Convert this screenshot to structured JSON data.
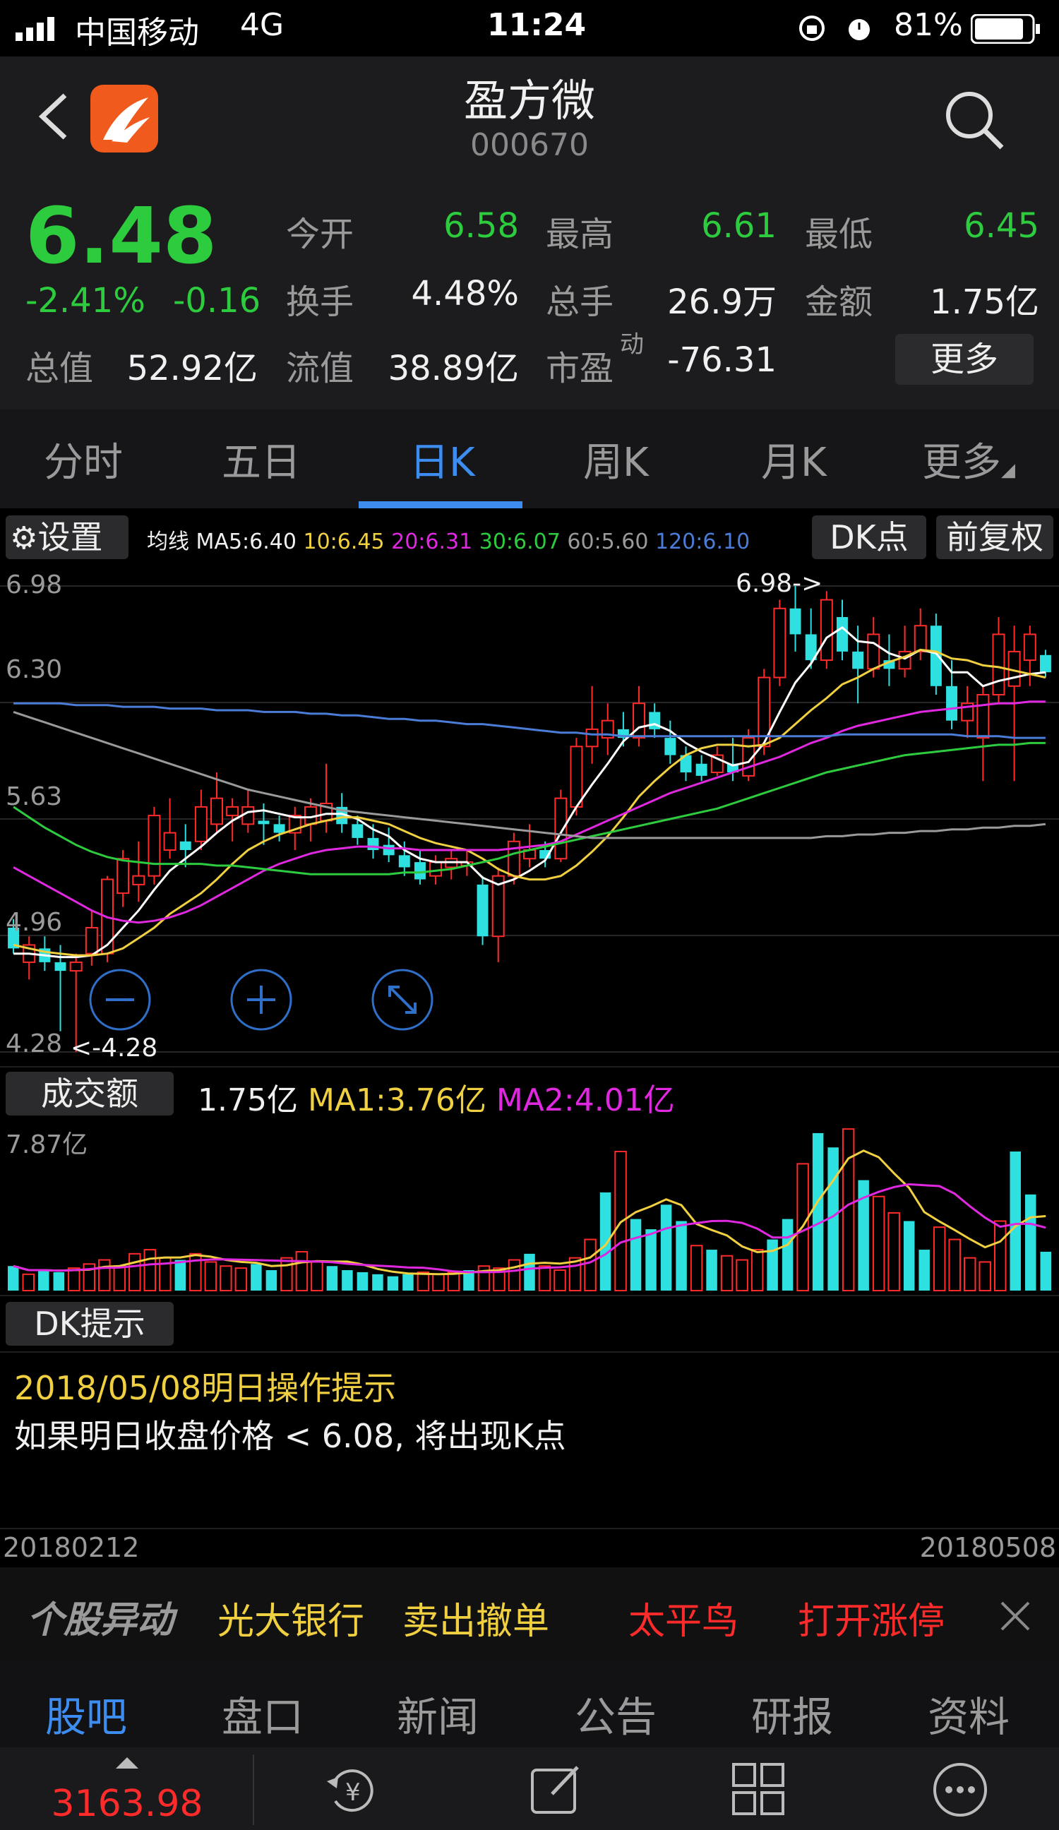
{
  "status": {
    "carrier": "中国移动",
    "network": "4G",
    "time": "11:24",
    "battery": "81%"
  },
  "header": {
    "name": "盈方微",
    "code": "000670"
  },
  "quote": {
    "price": "6.48",
    "change_pct": "-2.41%",
    "change": "-0.16",
    "open_label": "今开",
    "open": "6.58",
    "high_label": "最高",
    "high": "6.61",
    "low_label": "最低",
    "low": "6.45",
    "turnover_label": "换手",
    "turnover": "4.48%",
    "volume_label": "总手",
    "volume": "26.9万",
    "amount_label": "金额",
    "amount": "1.75亿",
    "mktcap_label": "总值",
    "mktcap": "52.92亿",
    "float_label": "流值",
    "float": "38.89亿",
    "pe_label": "市盈",
    "pe_sup": "动",
    "pe": "-76.31",
    "more": "更多"
  },
  "tabs": [
    {
      "label": "分时"
    },
    {
      "label": "五日"
    },
    {
      "label": "日K"
    },
    {
      "label": "周K"
    },
    {
      "label": "月K"
    },
    {
      "label": "更多"
    }
  ],
  "kline_toolbar": {
    "settings": "设置",
    "ma_title": "均线",
    "ma5": "MA5:6.40",
    "ma10": "10:6.45",
    "ma20": "20:6.31",
    "ma30": "30:6.07",
    "ma60": "60:5.60",
    "ma120": "120:6.10",
    "dk": "DK点",
    "adjust": "前复权"
  },
  "price_axis": [
    "6.98",
    "6.30",
    "5.63",
    "4.96",
    "4.28"
  ],
  "annotations": {
    "max": "6.98->",
    "min": "<-4.28"
  },
  "volume_header": {
    "label": "成交额",
    "value": "1.75亿",
    "ma1": "MA1:3.76亿",
    "ma2": "MA2:4.01亿",
    "axis_max": "7.87亿"
  },
  "dk": {
    "title": "DK提示",
    "date_line": "2018/05/08明日操作提示",
    "message": "如果明日收盘价格 < 6.08, 将出现K点"
  },
  "date_range": {
    "start": "20180212",
    "end": "20180508"
  },
  "news": {
    "title": "个股异动",
    "items": [
      "光大银行",
      "卖出撤单",
      "太平鸟",
      "打开涨停"
    ]
  },
  "bottom_tabs": [
    {
      "label": "股吧"
    },
    {
      "label": "盘口"
    },
    {
      "label": "新闻"
    },
    {
      "label": "公告"
    },
    {
      "label": "研报"
    },
    {
      "label": "资料"
    }
  ],
  "toolbar": {
    "index": "3163.98"
  },
  "colors": {
    "up": "#ff2b2b",
    "down": "#2ee0e0",
    "accent": "#3d8cf0"
  },
  "chart_data": {
    "type": "candlestick",
    "ylim": [
      4.28,
      6.98
    ],
    "candles": [
      {
        "o": 5.0,
        "h": 5.05,
        "l": 4.85,
        "c": 4.88
      },
      {
        "o": 4.8,
        "h": 4.95,
        "l": 4.7,
        "c": 4.9
      },
      {
        "o": 4.88,
        "h": 4.95,
        "l": 4.75,
        "c": 4.8
      },
      {
        "o": 4.8,
        "h": 4.9,
        "l": 4.4,
        "c": 4.75
      },
      {
        "o": 4.75,
        "h": 4.85,
        "l": 4.28,
        "c": 4.8
      },
      {
        "o": 4.85,
        "h": 5.1,
        "l": 4.78,
        "c": 5.0
      },
      {
        "o": 4.85,
        "h": 5.3,
        "l": 4.8,
        "c": 5.28
      },
      {
        "o": 5.2,
        "h": 5.45,
        "l": 5.12,
        "c": 5.4
      },
      {
        "o": 5.25,
        "h": 5.5,
        "l": 5.15,
        "c": 5.3
      },
      {
        "o": 5.3,
        "h": 5.7,
        "l": 5.25,
        "c": 5.65
      },
      {
        "o": 5.45,
        "h": 5.75,
        "l": 5.4,
        "c": 5.55
      },
      {
        "o": 5.5,
        "h": 5.6,
        "l": 5.35,
        "c": 5.45
      },
      {
        "o": 5.5,
        "h": 5.8,
        "l": 5.45,
        "c": 5.7
      },
      {
        "o": 5.6,
        "h": 5.9,
        "l": 5.55,
        "c": 5.75
      },
      {
        "o": 5.65,
        "h": 5.75,
        "l": 5.5,
        "c": 5.7
      },
      {
        "o": 5.6,
        "h": 5.8,
        "l": 5.55,
        "c": 5.7
      },
      {
        "o": 5.62,
        "h": 5.72,
        "l": 5.48,
        "c": 5.6
      },
      {
        "o": 5.6,
        "h": 5.65,
        "l": 5.5,
        "c": 5.55
      },
      {
        "o": 5.55,
        "h": 5.7,
        "l": 5.45,
        "c": 5.65
      },
      {
        "o": 5.6,
        "h": 5.75,
        "l": 5.5,
        "c": 5.7
      },
      {
        "o": 5.62,
        "h": 5.95,
        "l": 5.55,
        "c": 5.72
      },
      {
        "o": 5.7,
        "h": 5.78,
        "l": 5.55,
        "c": 5.6
      },
      {
        "o": 5.6,
        "h": 5.65,
        "l": 5.48,
        "c": 5.52
      },
      {
        "o": 5.52,
        "h": 5.6,
        "l": 5.4,
        "c": 5.45
      },
      {
        "o": 5.48,
        "h": 5.58,
        "l": 5.38,
        "c": 5.42
      },
      {
        "o": 5.42,
        "h": 5.5,
        "l": 5.3,
        "c": 5.35
      },
      {
        "o": 5.38,
        "h": 5.45,
        "l": 5.25,
        "c": 5.28
      },
      {
        "o": 5.3,
        "h": 5.42,
        "l": 5.25,
        "c": 5.38
      },
      {
        "o": 5.35,
        "h": 5.45,
        "l": 5.28,
        "c": 5.4
      },
      {
        "o": 5.36,
        "h": 5.45,
        "l": 5.3,
        "c": 5.38
      },
      {
        "o": 5.25,
        "h": 5.3,
        "l": 4.9,
        "c": 4.95
      },
      {
        "o": 4.95,
        "h": 5.35,
        "l": 4.8,
        "c": 5.3
      },
      {
        "o": 5.3,
        "h": 5.55,
        "l": 5.25,
        "c": 5.5
      },
      {
        "o": 5.4,
        "h": 5.6,
        "l": 5.35,
        "c": 5.45
      },
      {
        "o": 5.45,
        "h": 5.5,
        "l": 5.35,
        "c": 5.4
      },
      {
        "o": 5.4,
        "h": 5.8,
        "l": 5.38,
        "c": 5.75
      },
      {
        "o": 5.7,
        "h": 6.1,
        "l": 5.65,
        "c": 6.05
      },
      {
        "o": 6.05,
        "h": 6.4,
        "l": 5.95,
        "c": 6.15
      },
      {
        "o": 6.1,
        "h": 6.3,
        "l": 6.0,
        "c": 6.2
      },
      {
        "o": 6.15,
        "h": 6.25,
        "l": 6.05,
        "c": 6.1
      },
      {
        "o": 6.1,
        "h": 6.4,
        "l": 6.05,
        "c": 6.3
      },
      {
        "o": 6.25,
        "h": 6.3,
        "l": 6.1,
        "c": 6.15
      },
      {
        "o": 6.1,
        "h": 6.2,
        "l": 5.95,
        "c": 6.0
      },
      {
        "o": 6.0,
        "h": 6.05,
        "l": 5.85,
        "c": 5.9
      },
      {
        "o": 5.95,
        "h": 6.0,
        "l": 5.85,
        "c": 5.88
      },
      {
        "o": 5.9,
        "h": 6.05,
        "l": 5.88,
        "c": 6.0
      },
      {
        "o": 5.95,
        "h": 6.1,
        "l": 5.85,
        "c": 5.9
      },
      {
        "o": 5.88,
        "h": 6.15,
        "l": 5.85,
        "c": 6.1
      },
      {
        "o": 6.05,
        "h": 6.5,
        "l": 6.0,
        "c": 6.45
      },
      {
        "o": 6.45,
        "h": 6.9,
        "l": 6.4,
        "c": 6.85
      },
      {
        "o": 6.85,
        "h": 6.98,
        "l": 6.6,
        "c": 6.7
      },
      {
        "o": 6.7,
        "h": 6.85,
        "l": 6.5,
        "c": 6.55
      },
      {
        "o": 6.55,
        "h": 6.95,
        "l": 6.5,
        "c": 6.9
      },
      {
        "o": 6.8,
        "h": 6.9,
        "l": 6.55,
        "c": 6.6
      },
      {
        "o": 6.6,
        "h": 6.75,
        "l": 6.3,
        "c": 6.5
      },
      {
        "o": 6.5,
        "h": 6.8,
        "l": 6.45,
        "c": 6.7
      },
      {
        "o": 6.55,
        "h": 6.7,
        "l": 6.4,
        "c": 6.5
      },
      {
        "o": 6.5,
        "h": 6.75,
        "l": 6.45,
        "c": 6.6
      },
      {
        "o": 6.6,
        "h": 6.85,
        "l": 6.55,
        "c": 6.75
      },
      {
        "o": 6.75,
        "h": 6.82,
        "l": 6.35,
        "c": 6.4
      },
      {
        "o": 6.4,
        "h": 6.55,
        "l": 6.15,
        "c": 6.2
      },
      {
        "o": 6.2,
        "h": 6.4,
        "l": 6.1,
        "c": 6.3
      },
      {
        "o": 6.1,
        "h": 6.4,
        "l": 5.85,
        "c": 6.35
      },
      {
        "o": 6.35,
        "h": 6.8,
        "l": 6.3,
        "c": 6.7
      },
      {
        "o": 6.4,
        "h": 6.75,
        "l": 5.85,
        "c": 6.6
      },
      {
        "o": 6.55,
        "h": 6.75,
        "l": 6.4,
        "c": 6.7
      },
      {
        "o": 6.58,
        "h": 6.61,
        "l": 6.45,
        "c": 6.48
      }
    ],
    "ma_lines": [
      {
        "name": "MA5",
        "color": "#ffffff",
        "values": [
          4.85,
          4.85,
          4.84,
          4.83,
          4.83,
          4.84,
          4.9,
          5.0,
          5.1,
          5.22,
          5.33,
          5.4,
          5.47,
          5.55,
          5.62,
          5.67,
          5.68,
          5.66,
          5.64,
          5.64,
          5.66,
          5.66,
          5.63,
          5.57,
          5.53,
          5.45,
          5.4,
          5.38,
          5.38,
          5.38,
          5.29,
          5.25,
          5.28,
          5.33,
          5.39,
          5.55,
          5.7,
          5.83,
          5.95,
          6.08,
          6.16,
          6.18,
          6.14,
          6.07,
          6.02,
          5.98,
          5.94,
          5.96,
          6.07,
          6.25,
          6.42,
          6.53,
          6.68,
          6.74,
          6.66,
          6.65,
          6.59,
          6.56,
          6.61,
          6.59,
          6.48,
          6.48,
          6.4,
          6.43,
          6.45,
          6.47,
          6.48
        ]
      },
      {
        "name": "MA10",
        "color": "#f0d040",
        "values": [
          4.9,
          4.88,
          4.86,
          4.85,
          4.84,
          4.84,
          4.85,
          4.88,
          4.94,
          5.0,
          5.08,
          5.14,
          5.2,
          5.28,
          5.37,
          5.45,
          5.5,
          5.54,
          5.57,
          5.6,
          5.62,
          5.64,
          5.64,
          5.62,
          5.6,
          5.56,
          5.52,
          5.49,
          5.47,
          5.45,
          5.4,
          5.34,
          5.3,
          5.28,
          5.28,
          5.3,
          5.36,
          5.44,
          5.53,
          5.64,
          5.76,
          5.85,
          5.93,
          6.0,
          6.04,
          6.06,
          6.06,
          6.05,
          6.06,
          6.1,
          6.18,
          6.26,
          6.33,
          6.41,
          6.45,
          6.5,
          6.54,
          6.57,
          6.61,
          6.6,
          6.56,
          6.55,
          6.52,
          6.51,
          6.49,
          6.47,
          6.45
        ]
      },
      {
        "name": "MA20",
        "color": "#e028e0",
        "values": [
          5.35,
          5.3,
          5.25,
          5.2,
          5.15,
          5.1,
          5.06,
          5.04,
          5.03,
          5.04,
          5.06,
          5.09,
          5.13,
          5.18,
          5.23,
          5.28,
          5.33,
          5.37,
          5.4,
          5.43,
          5.45,
          5.46,
          5.47,
          5.47,
          5.46,
          5.46,
          5.45,
          5.45,
          5.45,
          5.45,
          5.45,
          5.45,
          5.46,
          5.47,
          5.48,
          5.5,
          5.54,
          5.58,
          5.62,
          5.66,
          5.7,
          5.74,
          5.78,
          5.81,
          5.84,
          5.87,
          5.9,
          5.93,
          5.96,
          5.99,
          6.03,
          6.07,
          6.1,
          6.14,
          6.17,
          6.19,
          6.21,
          6.23,
          6.25,
          6.26,
          6.27,
          6.28,
          6.29,
          6.3,
          6.3,
          6.31,
          6.31
        ]
      },
      {
        "name": "MA30",
        "color": "#2dcc3f",
        "values": [
          5.7,
          5.64,
          5.58,
          5.53,
          5.48,
          5.44,
          5.41,
          5.39,
          5.38,
          5.37,
          5.37,
          5.37,
          5.37,
          5.36,
          5.36,
          5.35,
          5.34,
          5.33,
          5.32,
          5.31,
          5.31,
          5.31,
          5.31,
          5.31,
          5.31,
          5.32,
          5.32,
          5.33,
          5.34,
          5.36,
          5.38,
          5.4,
          5.43,
          5.45,
          5.47,
          5.49,
          5.51,
          5.53,
          5.55,
          5.57,
          5.59,
          5.61,
          5.63,
          5.65,
          5.67,
          5.69,
          5.72,
          5.75,
          5.78,
          5.81,
          5.84,
          5.87,
          5.9,
          5.92,
          5.94,
          5.96,
          5.98,
          6.0,
          6.01,
          6.02,
          6.03,
          6.04,
          6.05,
          6.06,
          6.06,
          6.07,
          6.07
        ]
      },
      {
        "name": "MA60",
        "color": "#9a9a9a",
        "values": [
          6.25,
          6.22,
          6.19,
          6.16,
          6.13,
          6.1,
          6.07,
          6.04,
          6.01,
          5.98,
          5.95,
          5.92,
          5.89,
          5.86,
          5.83,
          5.8,
          5.78,
          5.76,
          5.74,
          5.72,
          5.7,
          5.68,
          5.67,
          5.66,
          5.65,
          5.64,
          5.63,
          5.62,
          5.61,
          5.6,
          5.59,
          5.58,
          5.57,
          5.56,
          5.55,
          5.54,
          5.53,
          5.52,
          5.52,
          5.52,
          5.52,
          5.52,
          5.52,
          5.52,
          5.52,
          5.52,
          5.52,
          5.52,
          5.52,
          5.52,
          5.52,
          5.52,
          5.53,
          5.53,
          5.54,
          5.54,
          5.55,
          5.55,
          5.56,
          5.56,
          5.57,
          5.57,
          5.58,
          5.58,
          5.59,
          5.59,
          5.6
        ]
      },
      {
        "name": "MA120",
        "color": "#4a7cd8",
        "values": [
          6.3,
          6.3,
          6.3,
          6.3,
          6.29,
          6.29,
          6.29,
          6.28,
          6.28,
          6.28,
          6.27,
          6.27,
          6.27,
          6.26,
          6.26,
          6.26,
          6.25,
          6.25,
          6.25,
          6.24,
          6.24,
          6.23,
          6.23,
          6.22,
          6.21,
          6.21,
          6.2,
          6.2,
          6.19,
          6.18,
          6.18,
          6.17,
          6.16,
          6.15,
          6.14,
          6.13,
          6.13,
          6.12,
          6.12,
          6.11,
          6.11,
          6.11,
          6.11,
          6.11,
          6.11,
          6.11,
          6.11,
          6.11,
          6.11,
          6.11,
          6.11,
          6.11,
          6.11,
          6.12,
          6.12,
          6.12,
          6.12,
          6.12,
          6.12,
          6.12,
          6.12,
          6.11,
          6.11,
          6.11,
          6.1,
          6.1,
          6.1
        ]
      }
    ],
    "volume": {
      "ymax": 7.87,
      "values": [
        1.2,
        0.8,
        1.0,
        0.9,
        1.1,
        1.3,
        1.5,
        1.2,
        1.8,
        2.0,
        1.6,
        1.5,
        1.8,
        1.4,
        1.2,
        1.1,
        1.3,
        1.0,
        1.6,
        1.9,
        1.4,
        1.2,
        1.0,
        0.9,
        0.8,
        0.7,
        0.8,
        0.9,
        0.8,
        0.9,
        1.0,
        1.2,
        1.1,
        1.5,
        1.8,
        1.2,
        1.0,
        1.6,
        2.5,
        4.8,
        6.8,
        3.5,
        3.0,
        4.2,
        3.4,
        2.2,
        2.0,
        1.7,
        1.5,
        2.0,
        2.5,
        3.5,
        6.2,
        7.7,
        7.0,
        7.9,
        5.4,
        4.6,
        3.8,
        3.4,
        2.0,
        3.1,
        2.5,
        1.6,
        1.4,
        3.4,
        6.8,
        4.7,
        1.9
      ]
    }
  }
}
